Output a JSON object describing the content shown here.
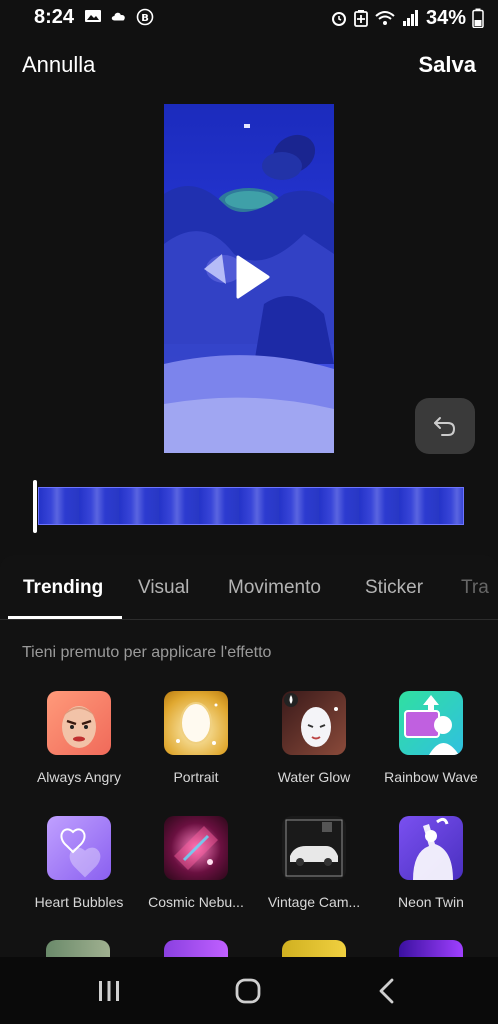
{
  "status_bar": {
    "time": "8:24",
    "battery": "34%",
    "left_icons": [
      "image-icon",
      "cloud-icon",
      "b-circle-icon"
    ],
    "right_icons": [
      "alarm-icon",
      "battery-saver-icon",
      "wifi-icon",
      "signal-icon",
      "battery-icon"
    ]
  },
  "header": {
    "cancel_label": "Annulla",
    "save_label": "Salva"
  },
  "tabs": [
    {
      "label": "Trending",
      "active": true
    },
    {
      "label": "Visual",
      "active": false
    },
    {
      "label": "Movimento",
      "active": false
    },
    {
      "label": "Sticker",
      "active": false
    },
    {
      "label": "Tra",
      "active": false
    }
  ],
  "hint": "Tieni premuto per applicare l'effetto",
  "effects": [
    {
      "label": "Always Angry"
    },
    {
      "label": "Portrait"
    },
    {
      "label": "Water Glow"
    },
    {
      "label": "Rainbow Wave"
    },
    {
      "label": "Heart Bubbles"
    },
    {
      "label": "Cosmic Nebu..."
    },
    {
      "label": "Vintage Cam..."
    },
    {
      "label": "Neon Twin"
    }
  ],
  "colors": {
    "background": "#111111",
    "accent_blue": "#2b3cd8"
  }
}
